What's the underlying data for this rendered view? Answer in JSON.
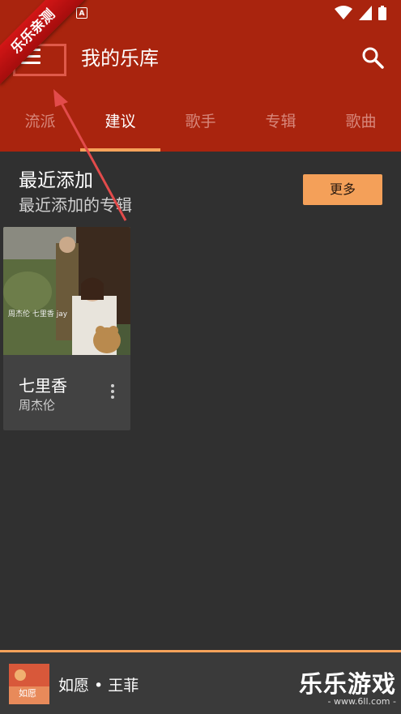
{
  "status_bar": {
    "notification_icon": "a-icon",
    "notification_letter": "A",
    "icons": [
      "wifi-icon",
      "cellular-signal-icon",
      "battery-icon"
    ]
  },
  "toolbar": {
    "title": "我的乐库",
    "menu_icon": "menu-icon",
    "search_icon": "search-icon"
  },
  "tabs": [
    {
      "label": "流派",
      "active": false
    },
    {
      "label": "建议",
      "active": true
    },
    {
      "label": "歌手",
      "active": false
    },
    {
      "label": "专辑",
      "active": false
    },
    {
      "label": "歌曲",
      "active": false
    }
  ],
  "section": {
    "title": "最近添加",
    "subtitle": "最近添加的专辑",
    "more_label": "更多"
  },
  "albums": [
    {
      "title": "七里香",
      "artist": "周杰伦",
      "cover_text": "周杰伦 七里香 jay"
    }
  ],
  "now_playing": {
    "text": "如愿 • 王菲",
    "art_text": "如愿"
  },
  "overlay": {
    "ribbon": "乐乐亲测",
    "watermark_big": "乐乐游戏",
    "watermark_small": "- www.6ll.com -"
  },
  "colors": {
    "accent": "#a9240e",
    "tab_indicator": "#f5a25a",
    "background": "#303030",
    "card": "#424242",
    "more_button": "#f4a059"
  }
}
